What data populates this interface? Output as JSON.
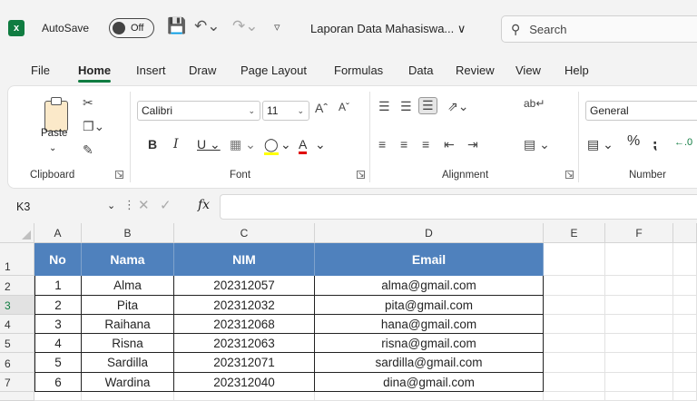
{
  "titlebar": {
    "autosave_label": "AutoSave",
    "autosave_state": "Off",
    "document_title": "Laporan Data Mahasiswa... ∨",
    "search_placeholder": "Search"
  },
  "tabs": [
    "File",
    "Home",
    "Insert",
    "Draw",
    "Page Layout",
    "Formulas",
    "Data",
    "Review",
    "View",
    "Help"
  ],
  "active_tab": "Home",
  "ribbon": {
    "clipboard": {
      "paste_label": "Paste",
      "group_label": "Clipboard"
    },
    "font": {
      "font_name": "Calibri",
      "font_size": "11",
      "group_label": "Font"
    },
    "alignment": {
      "group_label": "Alignment"
    },
    "number": {
      "format": "General",
      "group_label": "Number"
    }
  },
  "formula_bar": {
    "name_box": "K3",
    "fx_label": "fx"
  },
  "sheet": {
    "columns": [
      "A",
      "B",
      "C",
      "D",
      "E",
      "F"
    ],
    "rows": [
      "1",
      "2",
      "3",
      "4",
      "5",
      "6",
      "7"
    ],
    "selected_row": "3",
    "header": [
      "No",
      "Nama",
      "NIM",
      "Email"
    ],
    "data": [
      [
        "1",
        "Alma",
        "202312057",
        "alma@gmail.com"
      ],
      [
        "2",
        "Pita",
        "202312032",
        "pita@gmail.com"
      ],
      [
        "3",
        "Raihana",
        "202312068",
        "hana@gmail.com"
      ],
      [
        "4",
        "Risna",
        "202312063",
        "risna@gmail.com"
      ],
      [
        "5",
        "Sardilla",
        "202312071",
        "sardilla@gmail.com"
      ],
      [
        "6",
        "Wardina",
        "202312040",
        "dina@gmail.com"
      ]
    ],
    "header_color": "#4f81bd"
  },
  "colors": {
    "accent": "#107c41"
  }
}
